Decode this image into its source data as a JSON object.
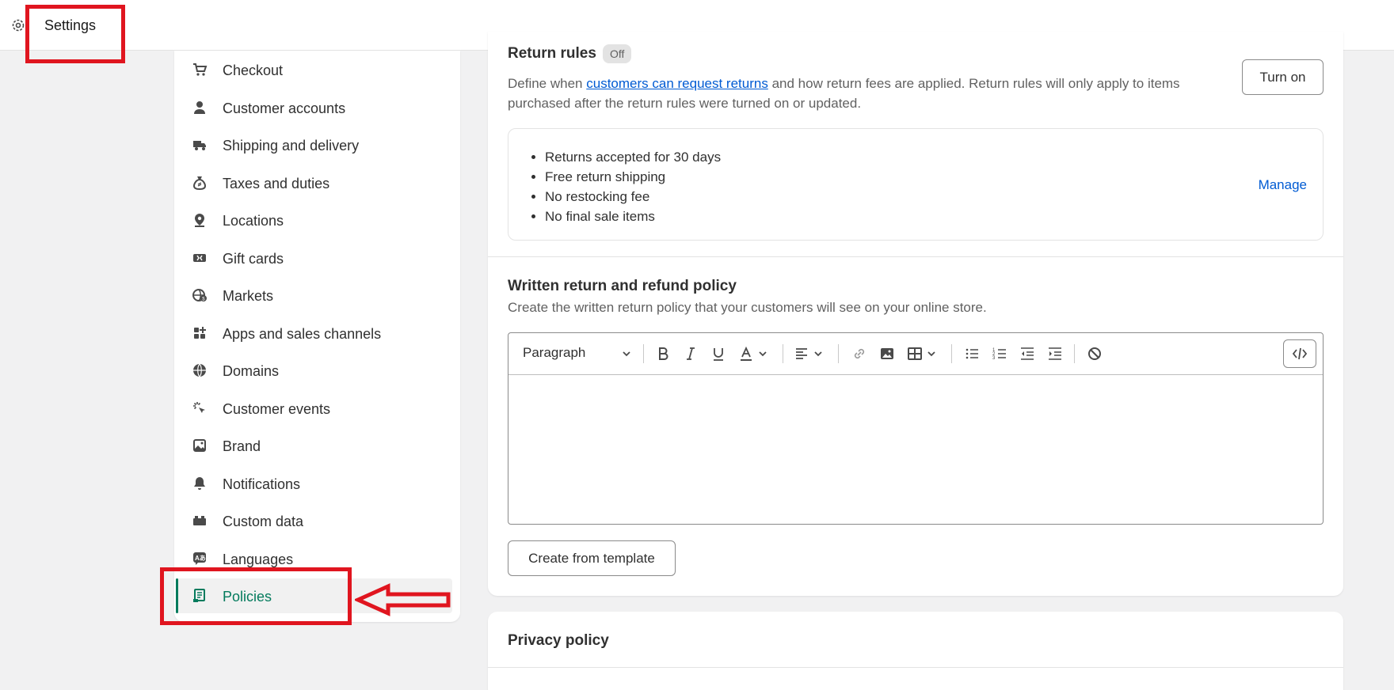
{
  "topbar": {
    "title": "Settings",
    "icon": "gear-icon"
  },
  "sidebar": {
    "items": [
      {
        "label": "Checkout",
        "icon": "cart-icon"
      },
      {
        "label": "Customer accounts",
        "icon": "person-icon"
      },
      {
        "label": "Shipping and delivery",
        "icon": "truck-icon"
      },
      {
        "label": "Taxes and duties",
        "icon": "money-bag-icon"
      },
      {
        "label": "Locations",
        "icon": "location-pin-icon"
      },
      {
        "label": "Gift cards",
        "icon": "gift-card-icon"
      },
      {
        "label": "Markets",
        "icon": "globe-dollar-icon"
      },
      {
        "label": "Apps and sales channels",
        "icon": "apps-icon"
      },
      {
        "label": "Domains",
        "icon": "globe-icon"
      },
      {
        "label": "Customer events",
        "icon": "cursor-click-icon"
      },
      {
        "label": "Brand",
        "icon": "image-icon"
      },
      {
        "label": "Notifications",
        "icon": "bell-icon"
      },
      {
        "label": "Custom data",
        "icon": "database-icon"
      },
      {
        "label": "Languages",
        "icon": "translate-icon"
      },
      {
        "label": "Policies",
        "icon": "policy-icon",
        "active": true
      }
    ]
  },
  "return_rules": {
    "title": "Return rules",
    "badge": "Off",
    "desc_prefix": "Define when ",
    "desc_link": "customers can request returns",
    "desc_suffix": " and how return fees are applied. Return rules will only apply to items purchased after the return rules were turned on or updated.",
    "turn_on_label": "Turn on",
    "rules": [
      "Returns accepted for 30 days",
      "Free return shipping",
      "No restocking fee",
      "No final sale items"
    ],
    "manage_label": "Manage"
  },
  "written_policy": {
    "title": "Written return and refund policy",
    "desc": "Create the written return policy that your customers will see on your online store.",
    "format_select": "Paragraph",
    "template_button": "Create from template"
  },
  "privacy": {
    "title": "Privacy policy"
  },
  "colors": {
    "accent": "#047b5d",
    "link": "#005bd3",
    "annotation": "#e0151f"
  }
}
